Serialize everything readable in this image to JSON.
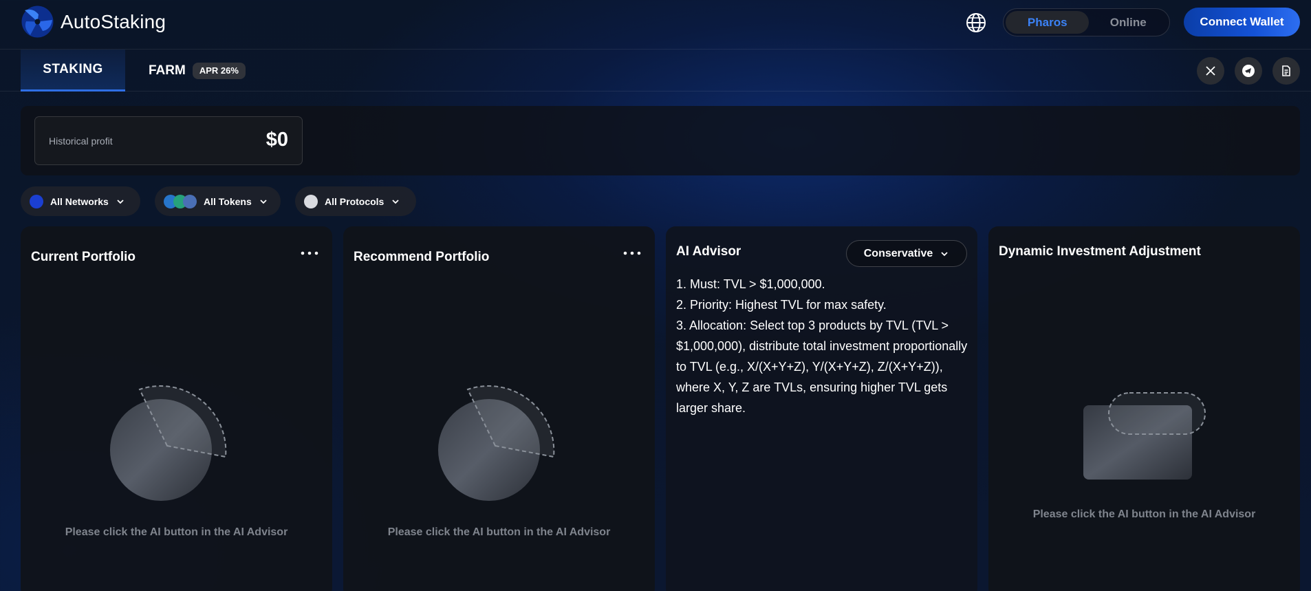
{
  "app": {
    "name": "AutoStaking"
  },
  "header": {
    "network_toggle": {
      "active": "Pharos",
      "inactive": "Online"
    },
    "connect_label": "Connect Wallet"
  },
  "tabs": {
    "staking": "STAKING",
    "farm": "FARM",
    "farm_badge": "APR 26%"
  },
  "profit": {
    "label": "Historical profit",
    "value": "$0"
  },
  "filters": {
    "networks": "All Networks",
    "tokens": "All Tokens",
    "protocols": "All Protocols"
  },
  "cards": {
    "current": {
      "title": "Current Portfolio",
      "empty": "Please click the AI button in the AI Advisor"
    },
    "recommend": {
      "title": "Recommend Portfolio",
      "empty": "Please click the AI button in the AI Advisor"
    },
    "advisor": {
      "title": "AI Advisor",
      "mode": "Conservative",
      "text": "1. Must: TVL > $1,000,000.\n2. Priority: Highest TVL for max safety.\n3. Allocation: Select top 3 products by TVL (TVL > $1,000,000), distribute total investment proportionally to TVL (e.g., X/(X+Y+Z), Y/(X+Y+Z), Z/(X+Y+Z)), where X, Y, Z are TVLs, ensuring higher TVL gets larger share."
    },
    "dynamic": {
      "title": "Dynamic Investment Adjustment",
      "empty": "Please click the AI button in the AI Advisor"
    }
  },
  "colors": {
    "accent": "#3b82f6",
    "connect": "#1452d6",
    "card_bg": "#101318"
  },
  "icons": [
    "autostaking-logo",
    "globe-icon",
    "x-icon",
    "telegram-icon",
    "document-icon",
    "chevron-down-icon",
    "more-dots-icon",
    "pie-placeholder-icon",
    "card-placeholder-icon"
  ]
}
